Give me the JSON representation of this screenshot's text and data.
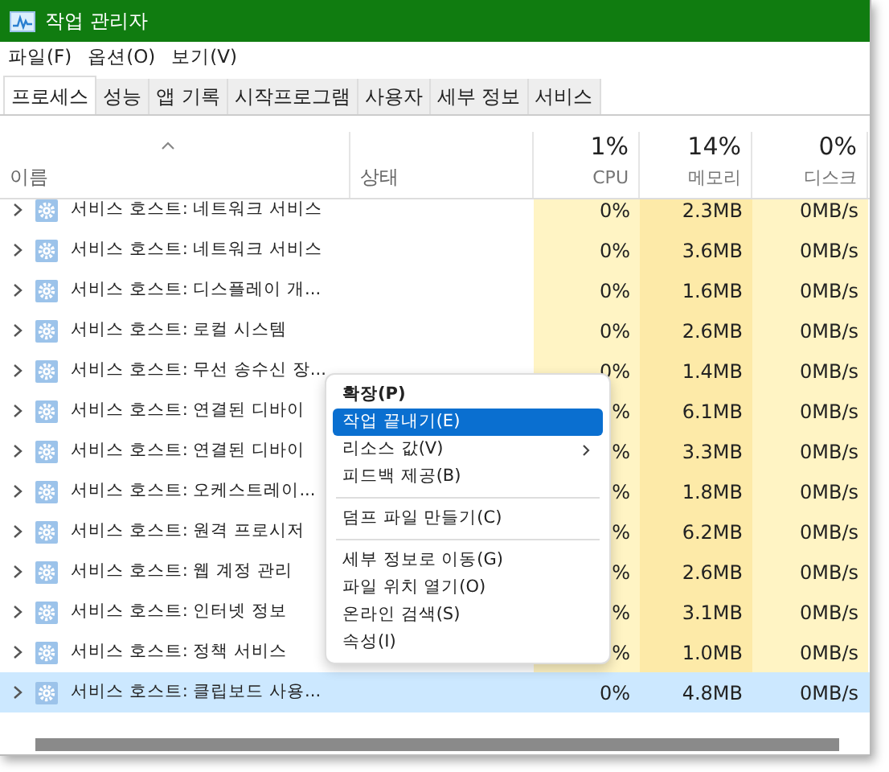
{
  "window": {
    "title": "작업 관리자"
  },
  "menu": [
    "파일(F)",
    "옵션(O)",
    "보기(V)"
  ],
  "tabs": [
    {
      "label": "프로세스",
      "selected": true
    },
    {
      "label": "성능",
      "selected": false
    },
    {
      "label": "앱 기록",
      "selected": false
    },
    {
      "label": "시작프로그램",
      "selected": false
    },
    {
      "label": "사용자",
      "selected": false
    },
    {
      "label": "세부 정보",
      "selected": false
    },
    {
      "label": "서비스",
      "selected": false
    }
  ],
  "columns": [
    {
      "kind": "name",
      "label": "이름"
    },
    {
      "kind": "status",
      "label": "상태"
    },
    {
      "kind": "usage",
      "percent": "1%",
      "label": "CPU"
    },
    {
      "kind": "usage",
      "percent": "14%",
      "label": "메모리"
    },
    {
      "kind": "usage",
      "percent": "0%",
      "label": "디스크"
    }
  ],
  "rows": [
    {
      "name": "서비스 호스트: 네트워크 서비스",
      "cpu": "0%",
      "memory": "2.3MB",
      "disk": "0MB/s",
      "selected": false
    },
    {
      "name": "서비스 호스트: 네트워크 서비스",
      "cpu": "0%",
      "memory": "3.6MB",
      "disk": "0MB/s",
      "selected": false
    },
    {
      "name": "서비스 호스트: 디스플레이 개...",
      "cpu": "0%",
      "memory": "1.6MB",
      "disk": "0MB/s",
      "selected": false
    },
    {
      "name": "서비스 호스트: 로컬 시스템",
      "cpu": "0%",
      "memory": "2.6MB",
      "disk": "0MB/s",
      "selected": false
    },
    {
      "name": "서비스 호스트: 무선 송수신 장...",
      "cpu": "0%",
      "memory": "1.4MB",
      "disk": "0MB/s",
      "selected": false
    },
    {
      "name": "서비스 호스트: 연결된 디바이",
      "cpu": "%",
      "memory": "6.1MB",
      "disk": "0MB/s",
      "selected": false
    },
    {
      "name": "서비스 호스트: 연결된 디바이",
      "cpu": "%",
      "memory": "3.3MB",
      "disk": "0MB/s",
      "selected": false
    },
    {
      "name": "서비스 호스트: 오케스트레이...",
      "cpu": "%",
      "memory": "1.8MB",
      "disk": "0MB/s",
      "selected": false
    },
    {
      "name": "서비스 호스트: 원격 프로시저",
      "cpu": "%",
      "memory": "6.2MB",
      "disk": "0MB/s",
      "selected": false
    },
    {
      "name": "서비스 호스트: 웹 계정 관리",
      "cpu": "%",
      "memory": "2.6MB",
      "disk": "0MB/s",
      "selected": false
    },
    {
      "name": "서비스 호스트: 인터넷 정보",
      "cpu": "%",
      "memory": "3.1MB",
      "disk": "0MB/s",
      "selected": false
    },
    {
      "name": "서비스 호스트: 정책 서비스",
      "cpu": "%",
      "memory": "1.0MB",
      "disk": "0MB/s",
      "selected": false
    },
    {
      "name": "서비스 호스트: 클립보드 사용...",
      "cpu": "0%",
      "memory": "4.8MB",
      "disk": "0MB/s",
      "selected": true
    }
  ],
  "context_menu": {
    "items": [
      {
        "kind": "item",
        "label": "확장(P)",
        "default": true,
        "selected": false,
        "submenu": false
      },
      {
        "kind": "item",
        "label": "작업 끝내기(E)",
        "default": false,
        "selected": true,
        "submenu": false
      },
      {
        "kind": "item",
        "label": "리소스 값(V)",
        "default": false,
        "selected": false,
        "submenu": true
      },
      {
        "kind": "item",
        "label": "피드백 제공(B)",
        "default": false,
        "selected": false,
        "submenu": false
      },
      {
        "kind": "separator"
      },
      {
        "kind": "item",
        "label": "덤프 파일 만들기(C)",
        "default": false,
        "selected": false,
        "submenu": false
      },
      {
        "kind": "separator"
      },
      {
        "kind": "item",
        "label": "세부 정보로 이동(G)",
        "default": false,
        "selected": false,
        "submenu": false
      },
      {
        "kind": "item",
        "label": "파일 위치 열기(O)",
        "default": false,
        "selected": false,
        "submenu": false
      },
      {
        "kind": "item",
        "label": "온라인 검색(S)",
        "default": false,
        "selected": false,
        "submenu": false
      },
      {
        "kind": "item",
        "label": "속성(I)",
        "default": false,
        "selected": false,
        "submenu": false
      }
    ]
  }
}
